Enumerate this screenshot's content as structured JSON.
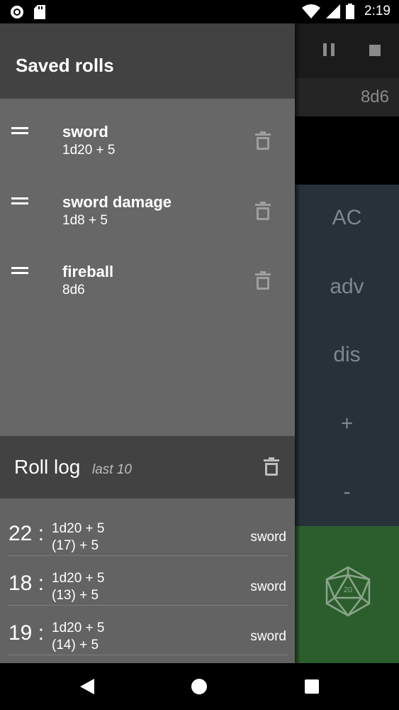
{
  "status_bar": {
    "time": "2:19",
    "left_icons": [
      "record-icon",
      "sd-card-icon"
    ],
    "right_icons": [
      "wifi-icon",
      "signal-icon",
      "battery-icon"
    ]
  },
  "background_app": {
    "expression": "8d6",
    "buttons": [
      "AC",
      "adv",
      "dis",
      "+",
      "-"
    ],
    "icons": [
      "pause-icon",
      "stop-icon",
      "d20-icon"
    ],
    "d20_label": "20"
  },
  "saved_rolls": {
    "title": "Saved rolls",
    "items": [
      {
        "name": "sword",
        "expression": "1d20 + 5"
      },
      {
        "name": "sword damage",
        "expression": "1d8 + 5"
      },
      {
        "name": "fireball",
        "expression": "8d6"
      }
    ]
  },
  "roll_log": {
    "title": "Roll log",
    "subtitle": "last 10",
    "entries": [
      {
        "total": "22 :",
        "expression": "1d20 + 5",
        "breakdown": "(17) + 5",
        "name": "sword"
      },
      {
        "total": "18 :",
        "expression": "1d20 + 5",
        "breakdown": "(13) + 5",
        "name": "sword"
      },
      {
        "total": "19 :",
        "expression": "1d20 + 5",
        "breakdown": "(14) + 5",
        "name": "sword"
      }
    ]
  },
  "nav_bar": {
    "icons": [
      "back-icon",
      "home-icon",
      "recents-icon"
    ]
  }
}
